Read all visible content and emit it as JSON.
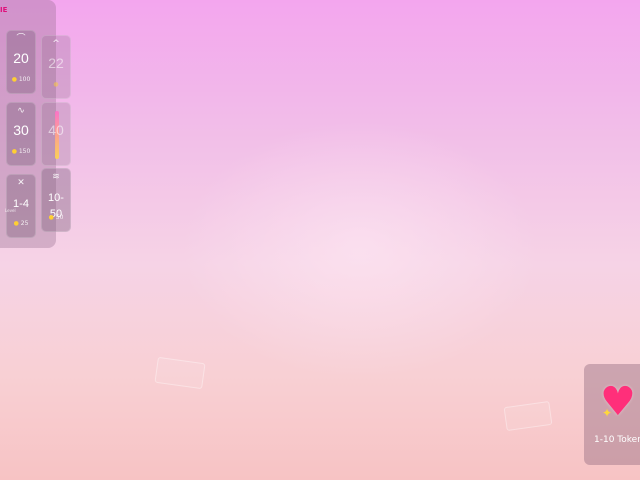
{
  "panel": {
    "tab_label": "IE",
    "tiles": [
      {
        "icon": "⌒",
        "value": "20",
        "cost": "100",
        "faded": false
      },
      {
        "icon": "^",
        "value": "22",
        "cost": "",
        "faded": true
      },
      {
        "icon": "∿",
        "value": "30",
        "cost": "150",
        "faded": false
      },
      {
        "icon": "",
        "value": "40",
        "cost": "",
        "faded": true
      },
      {
        "icon": "✕",
        "value": "1-4",
        "prefix": "Level",
        "cost": "25",
        "faded": false
      },
      {
        "icon": "≋",
        "value": "10-50",
        "cost": "50",
        "faded": false
      }
    ]
  },
  "reward": {
    "label": "1-10 Tokens",
    "icon": "sparkling-heart-icon"
  },
  "colors": {
    "accent": "#e0107a",
    "coin": "#ffcf33",
    "heart": "#ff2f7a"
  }
}
